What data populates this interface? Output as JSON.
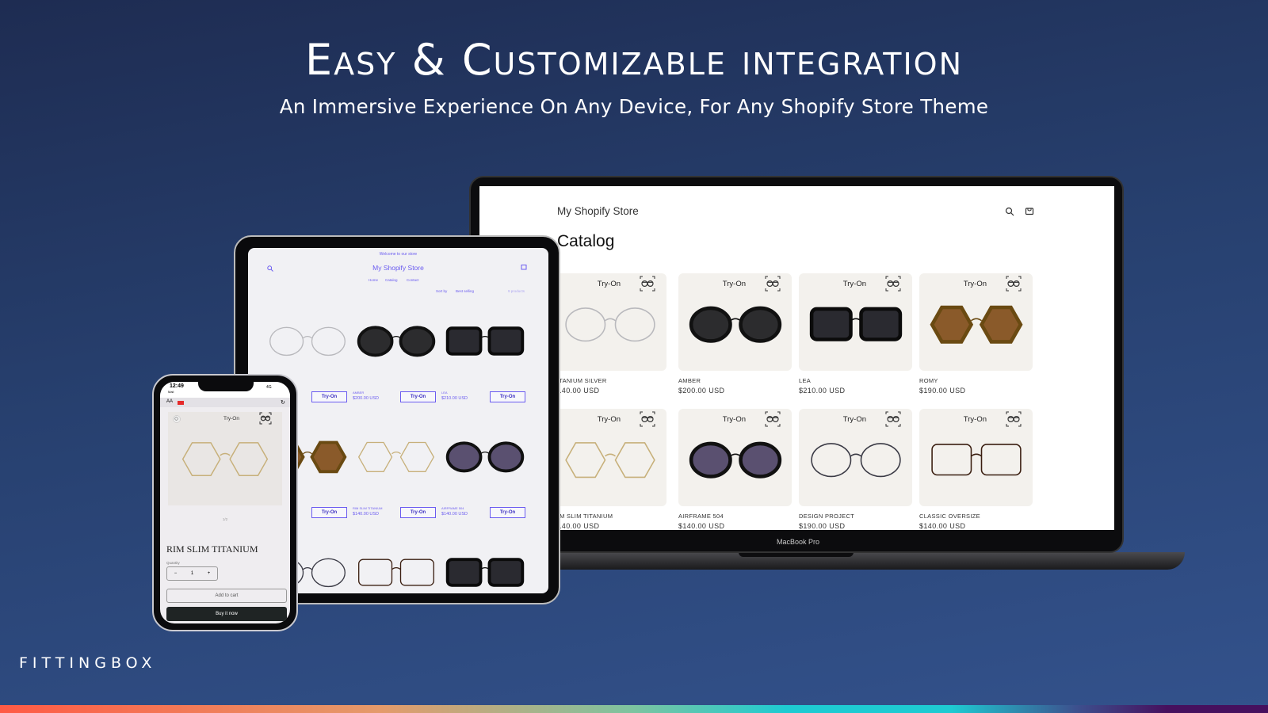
{
  "headline": {
    "title": "Easy & Customizable integration",
    "subtitle": "An Immersive Experience On Any Device, For Any Shopify Store Theme"
  },
  "brand": {
    "logo": "FITTINGBOX",
    "colors": {
      "background": "#27406f",
      "accent": "#6b5cf0"
    }
  },
  "laptop": {
    "device_label": "MacBook Pro",
    "store_name": "My Shopify Store",
    "page_title": "Catalog",
    "icons": [
      "search-icon",
      "cart-icon"
    ],
    "try_on_label": "Try-On",
    "products": [
      {
        "name": "TITANIUM SILVER",
        "price": "$140.00 USD",
        "shape": "round",
        "frame": "#b9b9bd",
        "lens": "none"
      },
      {
        "name": "AMBER",
        "price": "$200.00 USD",
        "shape": "round",
        "frame": "#111",
        "lens": "#2c2c2e"
      },
      {
        "name": "LEA",
        "price": "$210.00 USD",
        "shape": "square",
        "frame": "#0b0b0b",
        "lens": "#2a2a30"
      },
      {
        "name": "ROMY",
        "price": "$190.00 USD",
        "shape": "hex",
        "frame": "#6a4a12",
        "lens": "#8a5a2a"
      },
      {
        "name": "RIM SLIM TITANIUM",
        "price": "$140.00 USD",
        "shape": "hex",
        "frame": "#c7b07a",
        "lens": "none"
      },
      {
        "name": "AIRFRAME 504",
        "price": "$140.00 USD",
        "shape": "cat",
        "frame": "#111",
        "lens": "#5a5070"
      },
      {
        "name": "DESIGN PROJECT",
        "price": "$190.00 USD",
        "shape": "round",
        "frame": "#3a3a45",
        "lens": "none"
      },
      {
        "name": "CLASSIC OVERSIZE",
        "price": "$140.00 USD",
        "shape": "square",
        "frame": "#3a1e10",
        "lens": "none"
      }
    ]
  },
  "tablet": {
    "announcement": "Welcome to our store",
    "store_name": "My Shopify Store",
    "nav": [
      "Home",
      "Catalog",
      "Contact"
    ],
    "sort_label": "Sort by",
    "sort_value": "Best selling",
    "count": "9 products",
    "try_on_label": "Try-On",
    "labels": [
      {
        "name": "AMBER",
        "price": "$200.00 USD"
      },
      {
        "name": "LEA",
        "price": "$210.00 USD"
      },
      {
        "name": "RIM SLIM TITANIUM",
        "price": "$140.00 USD"
      },
      {
        "name": "AIRFRAME 504",
        "price": "$140.00 USD"
      }
    ]
  },
  "phone": {
    "time": "12:49",
    "carrier": "Mail",
    "signal": "4G",
    "text_size": "AA",
    "try_on_label": "Try-On",
    "pager": "1/2",
    "product_title": "RIM SLIM TITANIUM",
    "quantity_label": "Quantity",
    "quantity": "1",
    "add_to_cart": "Add to cart",
    "buy_now": "Buy it now"
  }
}
